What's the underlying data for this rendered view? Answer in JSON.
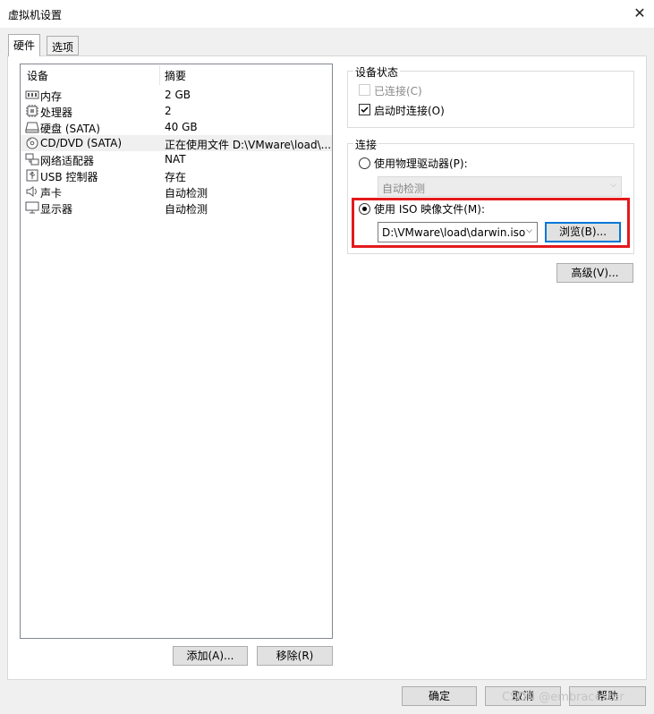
{
  "window": {
    "title": "虚拟机设置",
    "close_glyph": "✕"
  },
  "tabs": [
    {
      "label": "硬件",
      "active": true
    },
    {
      "label": "选项",
      "active": false
    }
  ],
  "device_list": {
    "headers": {
      "device": "设备",
      "summary": "摘要"
    },
    "rows": [
      {
        "icon": "memory-icon",
        "name": "内存",
        "summary": "2 GB"
      },
      {
        "icon": "processor-icon",
        "name": "处理器",
        "summary": "2"
      },
      {
        "icon": "hard-disk-icon",
        "name": "硬盘 (SATA)",
        "summary": "40 GB"
      },
      {
        "icon": "cd-dvd-icon",
        "name": "CD/DVD (SATA)",
        "summary": "正在使用文件 D:\\VMware\\load\\...",
        "selected": true
      },
      {
        "icon": "network-adapter-icon",
        "name": "网络适配器",
        "summary": "NAT"
      },
      {
        "icon": "usb-icon",
        "name": "USB 控制器",
        "summary": "存在"
      },
      {
        "icon": "sound-card-icon",
        "name": "声卡",
        "summary": "自动检测"
      },
      {
        "icon": "display-icon",
        "name": "显示器",
        "summary": "自动检测"
      }
    ],
    "add_button": "添加(A)...",
    "remove_button": "移除(R)"
  },
  "device_status": {
    "label": "设备状态",
    "connected": {
      "label": "已连接(C)",
      "checked": false,
      "disabled": true
    },
    "connect_at_power_on": {
      "label": "启动时连接(O)",
      "checked": true
    }
  },
  "connection": {
    "label": "连接",
    "physical_drive": {
      "label": "使用物理驱动器(P):",
      "selected": false
    },
    "physical_drive_select": {
      "value": "自动检测",
      "disabled": true
    },
    "iso_image": {
      "label": "使用 ISO 映像文件(M):",
      "selected": true
    },
    "iso_path": "D:\\VMware\\load\\darwin.iso",
    "browse_button": "浏览(B)..."
  },
  "advanced_button": "高级(V)...",
  "footer": {
    "ok": "确定",
    "cancel": "取消",
    "help": "帮助"
  },
  "watermark": "CSDN @embracestar",
  "colors": {
    "highlight": "#e3191c",
    "focus": "#0078d7",
    "background": "#f0f0f0"
  }
}
